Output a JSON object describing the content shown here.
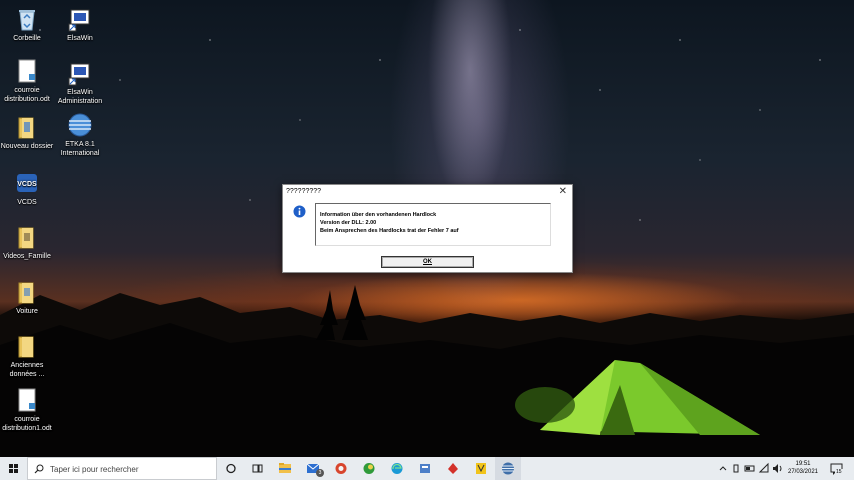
{
  "desktop": {
    "icons": [
      {
        "label": "Corbeille",
        "icon": "recycle-bin-icon"
      },
      {
        "label": "ElsaWin",
        "icon": "elsawin-shortcut-icon"
      },
      {
        "label": "courroie distribution.odt",
        "icon": "document-icon"
      },
      {
        "label": "ElsaWin Administration",
        "icon": "elsawin-admin-shortcut-icon"
      },
      {
        "label": "Nouveau dossier",
        "icon": "folder-icon"
      },
      {
        "label": "ETKA 8.1 International",
        "icon": "etka-globe-icon"
      },
      {
        "label": "VCDS",
        "icon": "vcds-icon"
      },
      {
        "label": "Videos_Famille",
        "icon": "folder-icon"
      },
      {
        "label": "Voiture",
        "icon": "folder-icon"
      },
      {
        "label": "Anciennes données ...",
        "icon": "folder-icon"
      },
      {
        "label": "courroie distribution1.odt",
        "icon": "document-icon"
      }
    ]
  },
  "dialog": {
    "title": "?????????",
    "close_label": "✕",
    "lines": [
      "Information über den vorhandenen Hardlock",
      "Version der DLL: 2.00",
      "Beim Ansprechen des Hardlocks trat der Fehler 7 auf"
    ],
    "ok_label": "OK",
    "info_icon": "info-icon"
  },
  "taskbar": {
    "search_placeholder": "Taper ici pour rechercher",
    "apps": [
      "cortana-icon",
      "task-view-icon",
      "file-explorer-icon",
      "mail-icon",
      "app-red-icon",
      "app-green-icon",
      "edge-icon",
      "app-blue-icon",
      "app-red-spade-icon",
      "app-yellow-icon",
      "etka-taskbar-icon"
    ],
    "mail_badge": "3",
    "time": "19:51",
    "date": "27/03/2021",
    "notification_count": "15"
  },
  "colors": {
    "taskbar_bg": "#e8ecf0",
    "accent": "#4a7bd1",
    "tent": "#8fd13a"
  }
}
